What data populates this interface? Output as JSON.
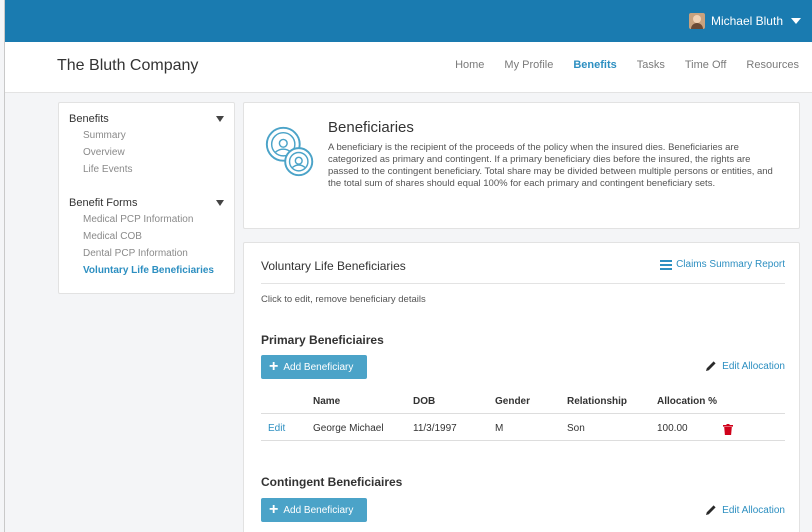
{
  "topbar": {
    "user_name": "Michael Bluth"
  },
  "header": {
    "company": "The Bluth Company",
    "nav": [
      "Home",
      "My Profile",
      "Benefits",
      "Tasks",
      "Time Off",
      "Resources"
    ],
    "active_nav": "Benefits"
  },
  "sidebar": {
    "group1_title": "Benefits",
    "group1_items": [
      "Summary",
      "Overview",
      "Life Events"
    ],
    "group2_title": "Benefit Forms",
    "group2_items": [
      "Medical PCP Information",
      "Medical COB",
      "Dental PCP Information",
      "Voluntary Life Beneficiaries"
    ],
    "active_item": "Voluntary Life Beneficiaries"
  },
  "intro": {
    "title": "Beneficiaries",
    "text": "A beneficiary is the recipient of the proceeds of the policy when the insured dies. Beneficiaries are categorized as primary and contingent. If a primary beneficiary dies before the insured, the rights are passed to the contingent beneficiary. Total share may be divided between multiple persons or entities, and the total sum of shares should equal 100% for each primary and contingent beneficiary sets."
  },
  "main": {
    "title": "Voluntary Life Beneficiaries",
    "claims_link": "Claims Summary Report",
    "hint": "Click to edit, remove beneficiary details",
    "primary_title": "Primary Beneficiaires",
    "contingent_title": "Contingent Beneficiaires",
    "add_button": "Add Beneficiary",
    "edit_allocation": "Edit Allocation",
    "table": {
      "headers": [
        "Name",
        "DOB",
        "Gender",
        "Relationship",
        "Allocation %"
      ],
      "rows": [
        {
          "edit": "Edit",
          "name": "George Michael",
          "dob": "11/3/1997",
          "gender": "M",
          "relationship": "Son",
          "allocation": "100.00"
        }
      ]
    }
  },
  "colors": {
    "topbar": "#1a7bb0",
    "accent": "#2d8fc1",
    "button": "#4ba3c8",
    "delete": "#d0021b"
  }
}
